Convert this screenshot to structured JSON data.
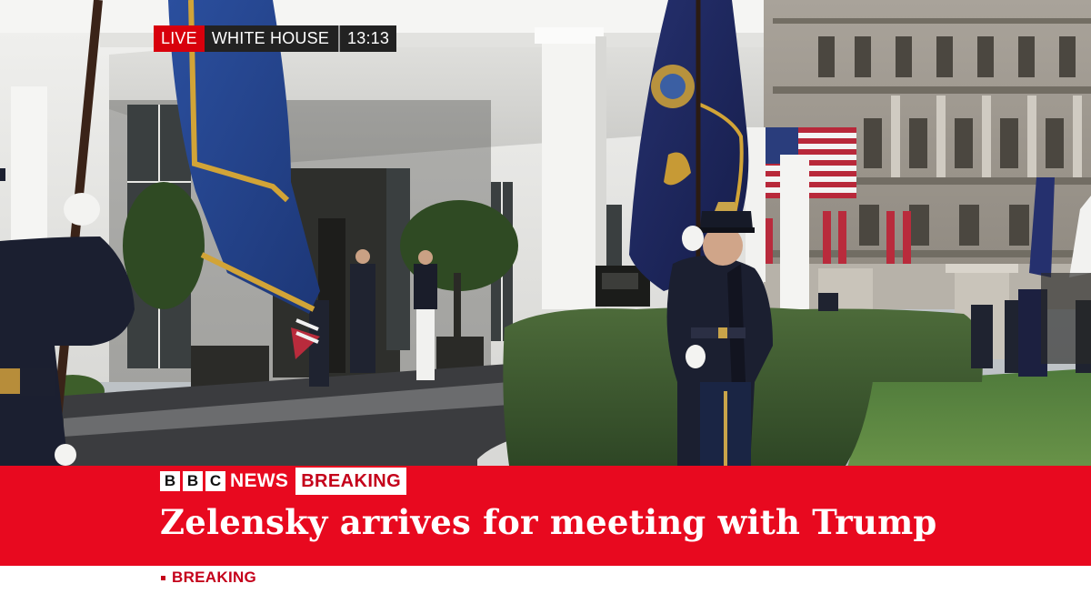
{
  "live_bug": {
    "live_label": "LIVE",
    "location": "WHITE HOUSE",
    "time": "13:13"
  },
  "banner": {
    "brand_letters": [
      "B",
      "B",
      "C"
    ],
    "brand_word": "NEWS",
    "tag": "BREAKING",
    "headline": "Zelensky arrives for meeting with Trump"
  },
  "ticker": {
    "label": "BREAKING"
  },
  "colors": {
    "bbc_red": "#e8091f",
    "live_red": "#d8000c",
    "bug_dark": "#222222",
    "ticker_white": "#ffffff"
  }
}
